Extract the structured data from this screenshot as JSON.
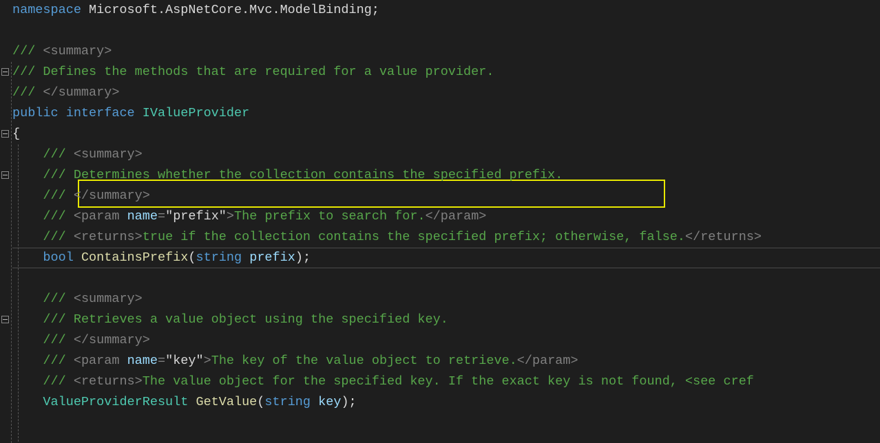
{
  "namespace_kw": "namespace",
  "namespace_name": " Microsoft.AspNetCore.Mvc.ModelBinding",
  "semicolon": ";",
  "xml": {
    "sl": "///",
    "summary_open": " <summary>",
    "summary_close": " </summary>",
    "param_open": " <param ",
    "param_name_attr": "name",
    "eq": "=",
    "param_close_tag": ">",
    "param_end": "</param>",
    "returns_open": " <returns>",
    "returns_end": "</returns>"
  },
  "interface": {
    "doc_line": " Defines the methods that are required for a value provider.",
    "public": "public",
    "interface_kw": " interface",
    "name": " IValueProvider"
  },
  "brace_open": "{",
  "brace_close": "}",
  "paren_open": "(",
  "paren_close": ")",
  "space": " ",
  "contains": {
    "summary": "Determines whether the collection contains the specified prefix.",
    "param_quoted": "\"prefix\"",
    "param_desc": "The prefix to search for.",
    "returns": "true if the collection contains the specified prefix; otherwise, false.",
    "ret_type": "bool",
    "method": " ContainsPrefix",
    "arg_type": "string",
    "arg_name": " prefix"
  },
  "getvalue": {
    "summary": " Retrieves a value object using the specified key.",
    "param_quoted": "\"key\"",
    "param_desc": "The key of the value object to retrieve.",
    "returns": "The value object for the specified key. If the exact key is not found, <see cref",
    "ret_type": "ValueProviderResult",
    "method": " GetValue",
    "arg_type": "string",
    "arg_name": " key"
  },
  "indent1": "    ",
  "indent_doc": "    "
}
